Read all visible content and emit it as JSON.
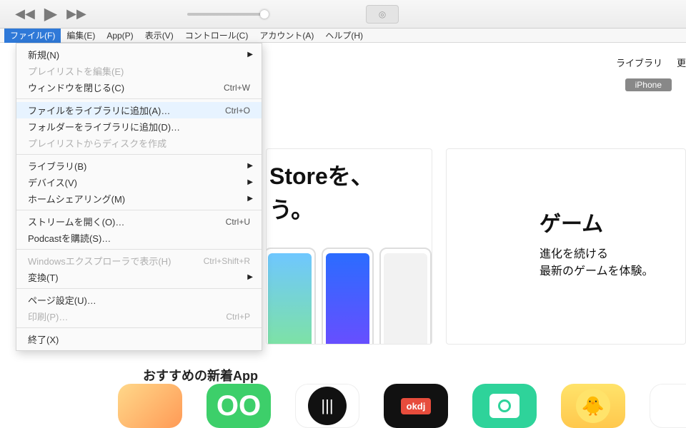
{
  "menubar": {
    "file": "ファイル(F)",
    "edit": "編集(E)",
    "app": "App(P)",
    "view": "表示(V)",
    "control": "コントロール(C)",
    "account": "アカウント(A)",
    "help": "ヘルプ(H)"
  },
  "header_right": {
    "library": "ライブラリ",
    "update": "更",
    "device": "iPhone"
  },
  "dropdown": {
    "new": "新規(N)",
    "edit_playlist": "プレイリストを編集(E)",
    "close_window": "ウィンドウを閉じる(C)",
    "close_window_sc": "Ctrl+W",
    "add_file": "ファイルをライブラリに追加(A)…",
    "add_file_sc": "Ctrl+O",
    "add_folder": "フォルダーをライブラリに追加(D)…",
    "burn_playlist": "プレイリストからディスクを作成",
    "library": "ライブラリ(B)",
    "devices": "デバイス(V)",
    "home_sharing": "ホームシェアリング(M)",
    "open_stream": "ストリームを開く(O)…",
    "open_stream_sc": "Ctrl+U",
    "subscribe_podcast": "Podcastを購読(S)…",
    "show_explorer": "Windowsエクスプローラで表示(H)",
    "show_explorer_sc": "Ctrl+Shift+R",
    "convert": "変換(T)",
    "page_setup": "ページ設定(U)…",
    "print": "印刷(P)…",
    "print_sc": "Ctrl+P",
    "exit": "終了(X)"
  },
  "promo": {
    "left_line1": " Storeを、",
    "left_line2": "う。",
    "right_title": "ゲーム",
    "right_line1": "進化を続ける",
    "right_line2": "最新のゲームを体験。"
  },
  "section_title": "おすすめの新着App",
  "apps": {
    "a2_text": "OO",
    "a4_text": "okdj"
  }
}
